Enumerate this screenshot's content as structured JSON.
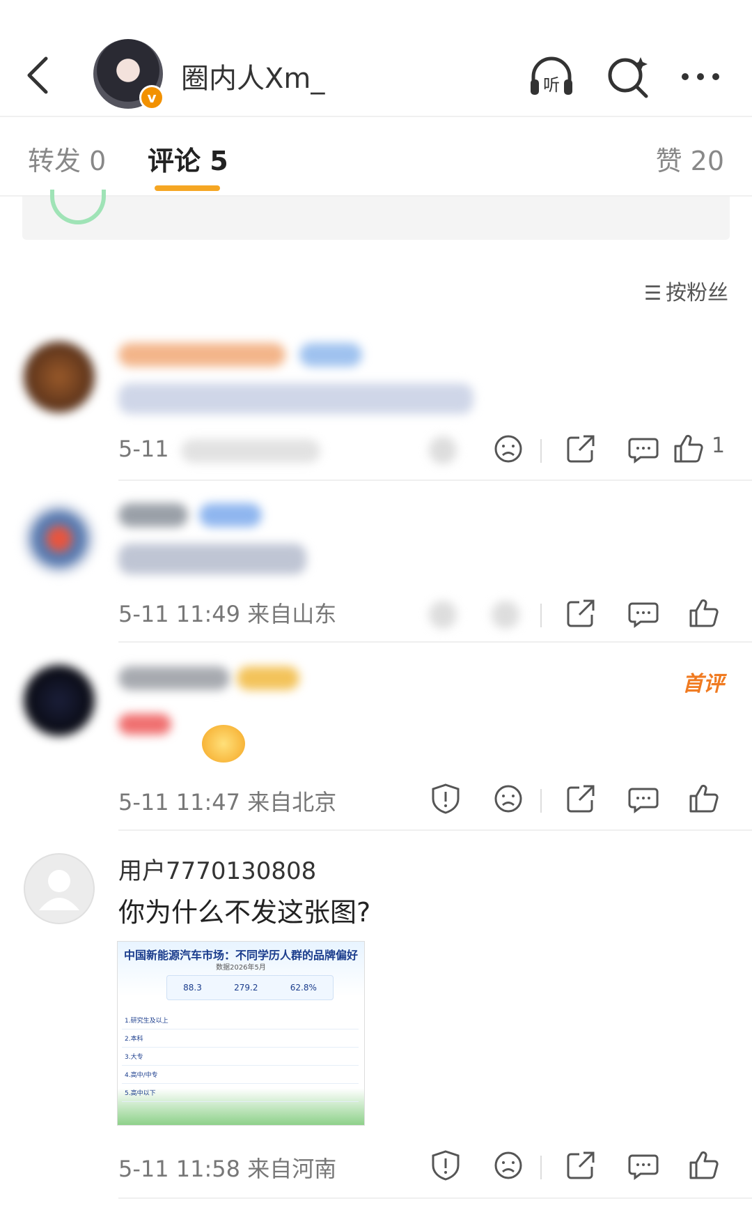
{
  "header": {
    "author_name": "圈内人Xm_",
    "listen_label": "听",
    "icons": [
      "back-arrow-icon",
      "headphones-icon",
      "search-icon",
      "more-icon"
    ]
  },
  "tabs": [
    {
      "label": "转发 0"
    },
    {
      "label": "评论 5"
    },
    {
      "label": "赞 20"
    }
  ],
  "sort_label": "按粉丝",
  "comments": [
    {
      "name": "",
      "text": "",
      "time": "5-11",
      "location": "",
      "likes": "1",
      "first_review": ""
    },
    {
      "name": "",
      "text": "",
      "time": "5-11 11:49",
      "location": "来自山东",
      "likes": "",
      "first_review": ""
    },
    {
      "name": "",
      "text": "",
      "time": "5-11 11:47",
      "location": "来自北京",
      "likes": "",
      "first_review": "首评"
    },
    {
      "name": "用户7770130808",
      "text": "你为什么不发这张图?",
      "time": "5-11 11:58",
      "location": "来自河南",
      "likes": "",
      "first_review": ""
    }
  ],
  "image": {
    "title": "中国新能源汽车市场：不同学历人群的品牌偏好",
    "subtitle": "数据2026年5月",
    "stats": [
      "88.3",
      "279.2",
      "62.8%"
    ],
    "rows": [
      "1.研究生及以上",
      "2.本科",
      "3.大专",
      "4.高中/中专",
      "5.高中以下"
    ]
  },
  "colors": {
    "accent": "#f5a623",
    "brand_orange": "#f07a20",
    "verified": "#f29100"
  }
}
